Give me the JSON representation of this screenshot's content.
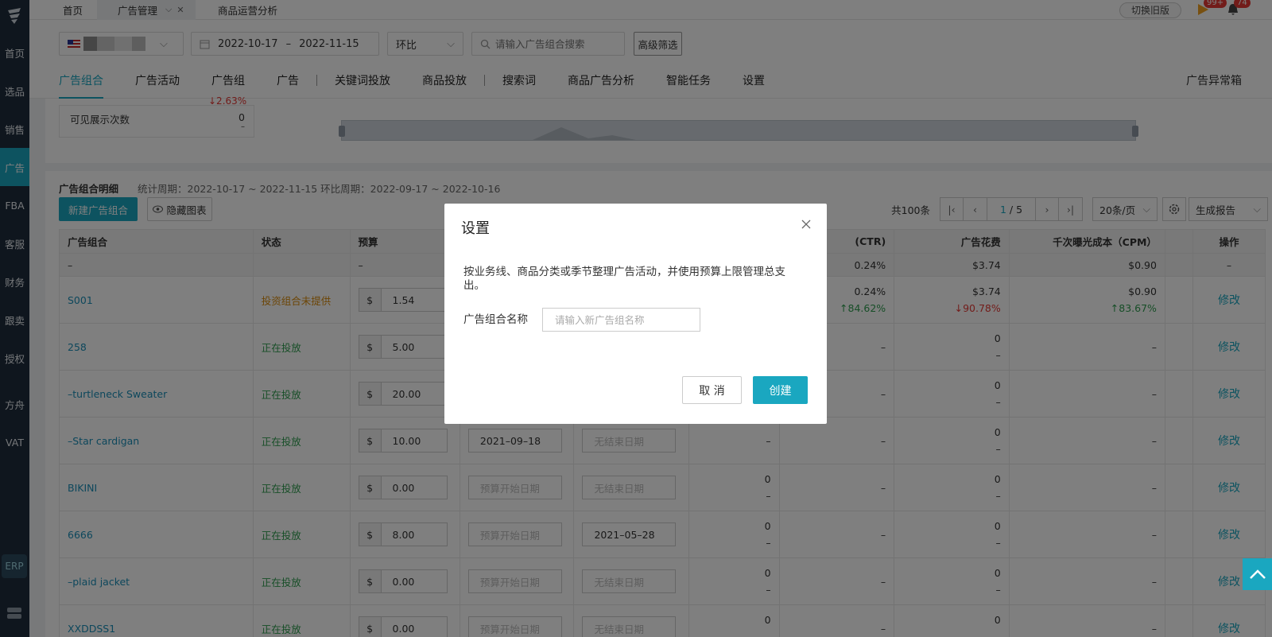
{
  "sidebar": {
    "items": [
      {
        "label": "首页"
      },
      {
        "label": "选品"
      },
      {
        "label": "销售"
      },
      {
        "label": "广告"
      },
      {
        "label": "FBA"
      },
      {
        "label": "客服"
      },
      {
        "label": "财务"
      },
      {
        "label": "跟卖"
      },
      {
        "label": "授权"
      },
      {
        "label": "方舟"
      },
      {
        "label": "VAT"
      }
    ],
    "erp_label": "ERP"
  },
  "tabs": {
    "home": "首页",
    "ad_manage": "广告管理",
    "product_analysis": "商品运营分析",
    "switch_old": "切换旧版",
    "notify_count": "99+",
    "alert_count": "74"
  },
  "filters": {
    "date_start": "2022-10-17",
    "date_sep": "–",
    "date_end": "2022-11-15",
    "compare": "环比",
    "search_placeholder": "请输入广告组合搜索",
    "advanced": "高级筛选"
  },
  "subnav": {
    "items": [
      "广告组合",
      "广告活动",
      "广告组",
      "广告",
      "关键词投放",
      "商品投放",
      "搜索词",
      "商品广告分析",
      "智能任务",
      "设置"
    ],
    "right": "广告异常箱"
  },
  "chart_panel": {
    "metric_change": "↓2.63%",
    "metric_label": "可见展示次数",
    "metric_value": "0",
    "metric_sub": "–"
  },
  "detail": {
    "title": "广告组合明细",
    "period": "统计周期：2022-10-17 ~ 2022-11-15 环比周期：2022-09-17 ~ 2022-10-16",
    "new_button": "新建广告组合",
    "hide_chart": "隐藏图表",
    "total": "共100条",
    "page_current": "1",
    "page_total": "/ 5",
    "page_size": "20条/页",
    "report": "生成报告"
  },
  "table": {
    "headers": [
      "广告组合",
      "状态",
      "预算",
      "",
      "",
      "",
      "(CTR)",
      "广告花费",
      "千次曝光成本（CPM）",
      "",
      "操作"
    ],
    "summary": {
      "name": "–",
      "budget": "–",
      "ctr": "0.24%",
      "spend": "$3.74",
      "cpm": "$0.90",
      "op": "–"
    },
    "currency": "$",
    "edit_label": "修改",
    "rows": [
      {
        "name": "S001",
        "status": "投资组合未提供",
        "budget": "1.54",
        "start": "",
        "end": "",
        "imp": "",
        "imp_sub": "",
        "ctr": "0.24%",
        "ctr_sub": "↑84.62%",
        "spend": "$3.74",
        "spend_sub": "↓90.78%",
        "cpm": "$0.90",
        "cpm_sub": "↑83.67%"
      },
      {
        "name": "258",
        "status": "正在投放",
        "budget": "5.00",
        "start": "",
        "end": "",
        "imp": "",
        "imp_sub": "",
        "ctr": "–",
        "ctr_sub": "",
        "spend": "0",
        "spend_sub": "–",
        "cpm": "–",
        "cpm_sub": ""
      },
      {
        "name": "–turtleneck Sweater",
        "status": "正在投放",
        "budget": "20.00",
        "start": "",
        "end": "",
        "imp": "",
        "imp_sub": "",
        "ctr": "–",
        "ctr_sub": "",
        "spend": "0",
        "spend_sub": "–",
        "cpm": "–",
        "cpm_sub": ""
      },
      {
        "name": "–Star cardigan",
        "status": "正在投放",
        "budget": "10.00",
        "start": "2021–09–18",
        "end": "无结束日期",
        "imp": "",
        "imp_sub": "–",
        "ctr": "–",
        "ctr_sub": "",
        "spend": "0",
        "spend_sub": "–",
        "cpm": "–",
        "cpm_sub": ""
      },
      {
        "name": "BIKINI",
        "status": "正在投放",
        "budget": "0.00",
        "start": "预算开始日期",
        "end": "无结束日期",
        "imp": "0",
        "imp_sub": "–",
        "ctr": "–",
        "ctr_sub": "",
        "spend": "0",
        "spend_sub": "–",
        "cpm": "–",
        "cpm_sub": ""
      },
      {
        "name": "6666",
        "status": "正在投放",
        "budget": "8.00",
        "start": "预算开始日期",
        "end": "2021–05–28",
        "imp": "0",
        "imp_sub": "–",
        "ctr": "–",
        "ctr_sub": "",
        "spend": "0",
        "spend_sub": "–",
        "cpm": "–",
        "cpm_sub": ""
      },
      {
        "name": "–plaid jacket",
        "status": "正在投放",
        "budget": "0.00",
        "start": "预算开始日期",
        "end": "无结束日期",
        "imp": "0",
        "imp_sub": "–",
        "ctr": "–",
        "ctr_sub": "",
        "spend": "0",
        "spend_sub": "–",
        "cpm": "–",
        "cpm_sub": ""
      },
      {
        "name": "XXDDSS1",
        "status": "正在投放",
        "budget": "0.00",
        "start": "预算开始日期",
        "end": "无结束日期",
        "imp": "0",
        "imp_sub": "–",
        "ctr": "–",
        "ctr_sub": "",
        "spend": "0",
        "spend_sub": "–",
        "cpm": "–",
        "cpm_sub": ""
      }
    ]
  },
  "modal": {
    "title": "设置",
    "description": "按业务线、商品分类或季节整理广告活动，并使用预算上限管理总支出。",
    "name_label": "广告组合名称",
    "name_placeholder": "请输入新广告组名称",
    "name_value": "",
    "cancel": "取 消",
    "create": "创建"
  },
  "colors": {
    "accent": "#1aa7c0",
    "sidebar": "#1f2d3d",
    "positive": "#2e9d4f",
    "negative": "#e53935",
    "warning": "#d88a0a"
  }
}
